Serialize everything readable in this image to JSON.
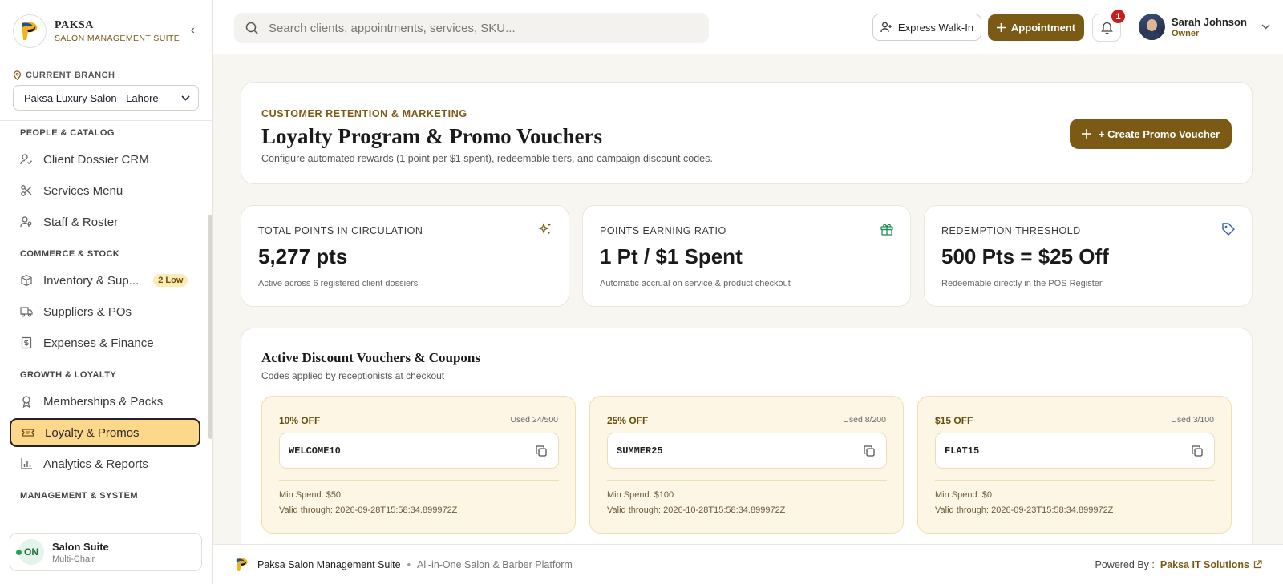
{
  "brand": {
    "name": "PAKSA",
    "subtitle": "SALON MANAGEMENT SUITE"
  },
  "branch": {
    "label": "CURRENT BRANCH",
    "selected": "Paksa Luxury Salon - Lahore"
  },
  "nav": {
    "sections": [
      {
        "title": "PEOPLE & CATALOG",
        "items": [
          {
            "label": "Client Dossier CRM",
            "icon": "user-check-icon"
          },
          {
            "label": "Services Menu",
            "icon": "scissors-icon"
          },
          {
            "label": "Staff & Roster",
            "icon": "users-icon"
          }
        ]
      },
      {
        "title": "COMMERCE & STOCK",
        "items": [
          {
            "label": "Inventory & Sup...",
            "icon": "box-icon",
            "badge": "2 Low"
          },
          {
            "label": "Suppliers & POs",
            "icon": "truck-icon"
          },
          {
            "label": "Expenses & Finance",
            "icon": "receipt-icon"
          }
        ]
      },
      {
        "title": "GROWTH & LOYALTY",
        "items": [
          {
            "label": "Memberships & Packs",
            "icon": "award-icon"
          },
          {
            "label": "Loyalty & Promos",
            "icon": "ticket-icon",
            "active": true
          },
          {
            "label": "Analytics & Reports",
            "icon": "bar-chart-icon"
          }
        ]
      },
      {
        "title": "MANAGEMENT & SYSTEM"
      }
    ]
  },
  "suite": {
    "badge": "ON",
    "name": "Salon Suite",
    "sub": "Multi-Chair"
  },
  "topbar": {
    "search_placeholder": "Search clients, appointments, services, SKU...",
    "walkin_label": "Express Walk-In",
    "appointment_label": "Appointment",
    "notification_count": "1",
    "user_name": "Sarah Johnson",
    "user_role": "Owner"
  },
  "hero": {
    "eyebrow": "CUSTOMER RETENTION & MARKETING",
    "title": "Loyalty Program & Promo Vouchers",
    "description": "Configure automated rewards (1 point per $1 spent), redeemable tiers, and campaign discount codes.",
    "create_label": "+ Create Promo Voucher"
  },
  "stats": [
    {
      "label": "TOTAL POINTS IN CIRCULATION",
      "value": "5,277 pts",
      "sub": "Active across 6 registered client dossiers",
      "icon": "sparkles-icon",
      "color": "#7a5a15"
    },
    {
      "label": "POINTS EARNING RATIO",
      "value": "1 Pt / $1 Spent",
      "sub": "Automatic accrual on service & product checkout",
      "icon": "gift-icon",
      "color": "#1f8a5a"
    },
    {
      "label": "REDEMPTION THRESHOLD",
      "value": "500 Pts = $25 Off",
      "sub": "Redeemable directly in the POS Register",
      "icon": "tag-icon",
      "color": "#2f5fb3"
    }
  ],
  "vouchers": {
    "title": "Active Discount Vouchers & Coupons",
    "subtitle": "Codes applied by receptionists at checkout",
    "items": [
      {
        "discount": "10% OFF",
        "used": "Used 24/500",
        "code": "WELCOME10",
        "min_spend": "Min Spend: $50",
        "valid": "Valid through: 2026-09-28T15:58:34.899972Z"
      },
      {
        "discount": "25% OFF",
        "used": "Used 8/200",
        "code": "SUMMER25",
        "min_spend": "Min Spend: $100",
        "valid": "Valid through: 2026-10-28T15:58:34.899972Z"
      },
      {
        "discount": "$15 OFF",
        "used": "Used 3/100",
        "code": "FLAT15",
        "min_spend": "Min Spend: $0",
        "valid": "Valid through: 2026-09-23T15:58:34.899972Z"
      }
    ]
  },
  "footer": {
    "name": "Paksa Salon Management Suite",
    "separator": "•",
    "tagline": "All-in-One Salon & Barber Platform",
    "powered": "Powered By :",
    "company": "Paksa IT Solutions"
  },
  "colors": {
    "accent": "#7a5a15",
    "active_nav": "#fdd88a",
    "voucher_bg": "#fdf6e4"
  }
}
